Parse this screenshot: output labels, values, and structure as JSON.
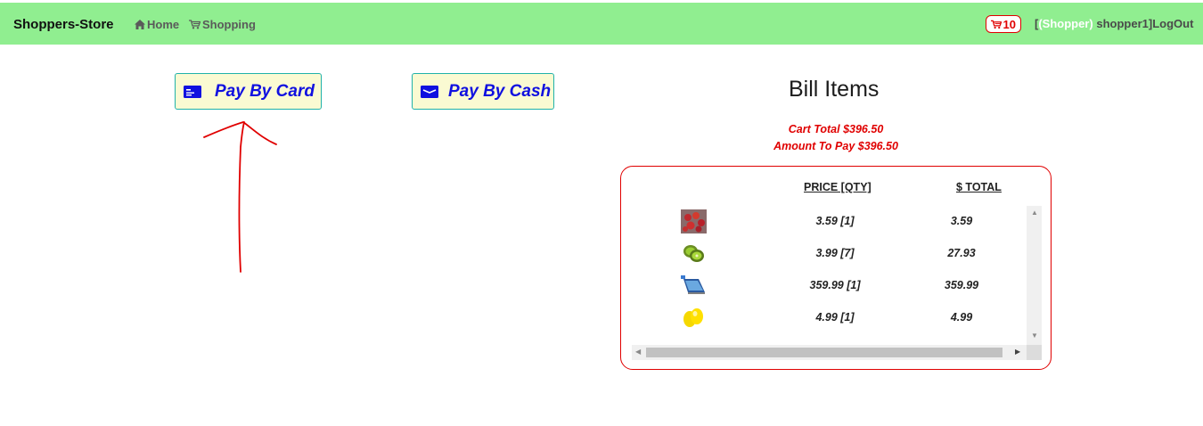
{
  "header": {
    "brand": "Shoppers-Store",
    "nav": [
      {
        "label": "Home",
        "icon": "home-icon"
      },
      {
        "label": "Shopping",
        "icon": "cart-icon"
      }
    ],
    "cart_count": "10",
    "user_open": "[",
    "user_role": "(Shopper)",
    "user_name": " shopper1]",
    "logout_label": "LogOut",
    "bar_color": "#90ee90"
  },
  "payment": {
    "card_label": "Pay By Card",
    "cash_label": "Pay By Cash",
    "button_text_color": "#1010e0",
    "button_bg": "#fafad2"
  },
  "bill": {
    "title": "Bill Items",
    "cart_total": "Cart Total $396.50",
    "amount_to_pay": "Amount To Pay $396.50",
    "columns": {
      "price_qty": "PRICE [QTY]",
      "total": "$ TOTAL"
    },
    "items": [
      {
        "image": "strawberries-image",
        "price_qty": "3.59 [1]",
        "total": "3.59"
      },
      {
        "image": "kiwi-image",
        "price_qty": "3.99 [7]",
        "total": "27.93"
      },
      {
        "image": "tablet-image",
        "price_qty": "359.99 [1]",
        "total": "359.99"
      },
      {
        "image": "lemon-image",
        "price_qty": "4.99 [1]",
        "total": "4.99"
      }
    ]
  },
  "annotation": {
    "arrow_color": "#e00000",
    "points_to": "Pay By Card"
  }
}
